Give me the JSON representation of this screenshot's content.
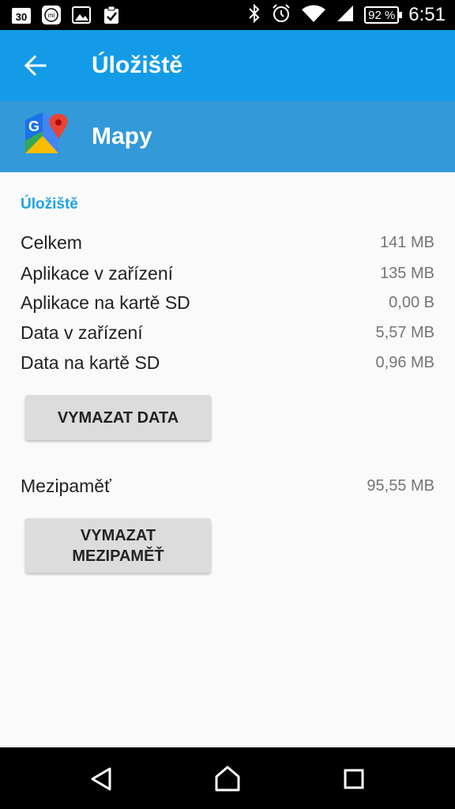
{
  "status_bar": {
    "notification_icons": [
      "calendar-30-icon",
      "mi-icon",
      "image-icon",
      "clipboard-check-icon"
    ],
    "calendar_day": "30",
    "battery": "92 %",
    "time": "6:51"
  },
  "app_bar": {
    "title": "Úložiště"
  },
  "app_header": {
    "name": "Mapy"
  },
  "storage": {
    "section_title": "Úložiště",
    "rows": [
      {
        "label": "Celkem",
        "value": "141 MB"
      },
      {
        "label": "Aplikace v zařízení",
        "value": "135 MB"
      },
      {
        "label": "Aplikace na kartě SD",
        "value": "0,00 B"
      },
      {
        "label": "Data v zařízení",
        "value": "5,57 MB"
      },
      {
        "label": "Data na kartě SD",
        "value": "0,96 MB"
      }
    ],
    "clear_data_label": "VYMAZAT DATA"
  },
  "cache": {
    "label": "Mezipaměť",
    "value": "95,55 MB",
    "clear_cache_label": "VYMAZAT\nMEZIPAMĚŤ"
  },
  "colors": {
    "app_bar": "#139be8",
    "app_header": "#3399d9",
    "accent": "#1ea3e6"
  }
}
